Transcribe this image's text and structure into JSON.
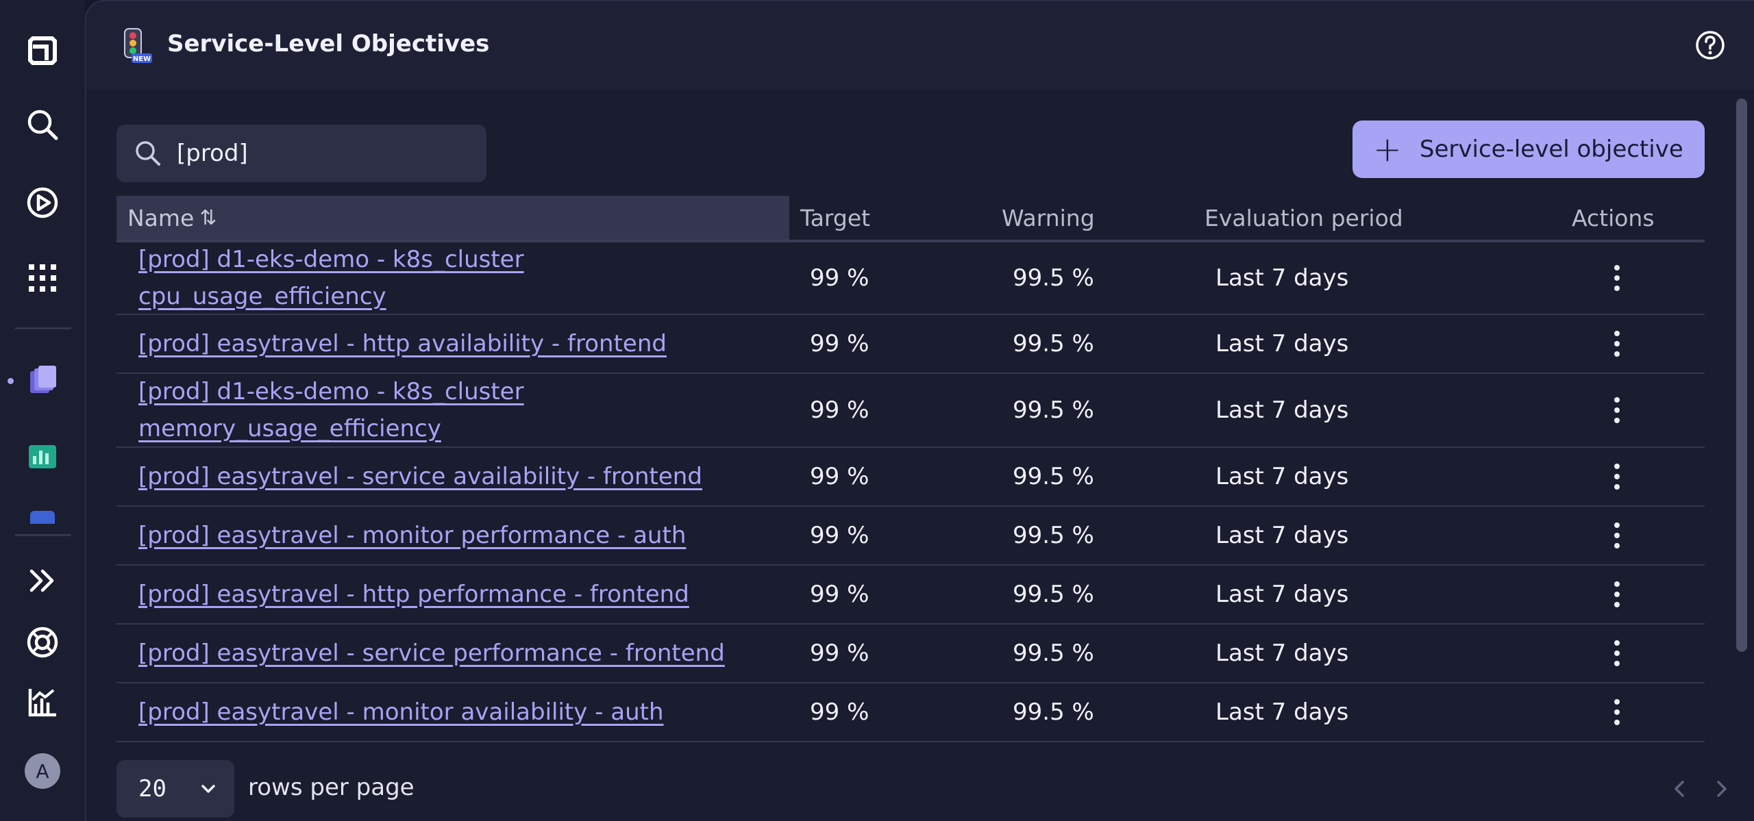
{
  "header": {
    "title": "Service-Level Objectives",
    "app_badge": "NEW"
  },
  "search": {
    "value": "[prod]",
    "placeholder": "Search"
  },
  "toolbar": {
    "add_button_label": "Service-level objective"
  },
  "table": {
    "columns": {
      "name": "Name",
      "target": "Target",
      "warning": "Warning",
      "evaluation_period": "Evaluation period",
      "actions": "Actions"
    },
    "rows": [
      {
        "name": "[prod] d1-eks-demo - k8s_cluster cpu_usage_efficiency",
        "target": "99 %",
        "warning": "99.5 %",
        "evaluation_period": "Last 7 days"
      },
      {
        "name": "[prod] easytravel - http availability - frontend",
        "target": "99 %",
        "warning": "99.5 %",
        "evaluation_period": "Last 7 days"
      },
      {
        "name": "[prod] d1-eks-demo - k8s_cluster memory_usage_efficiency",
        "target": "99 %",
        "warning": "99.5 %",
        "evaluation_period": "Last 7 days"
      },
      {
        "name": "[prod] easytravel - service availability - frontend",
        "target": "99 %",
        "warning": "99.5 %",
        "evaluation_period": "Last 7 days"
      },
      {
        "name": "[prod] easytravel - monitor performance - auth",
        "target": "99 %",
        "warning": "99.5 %",
        "evaluation_period": "Last 7 days"
      },
      {
        "name": "[prod] easytravel - http performance - frontend",
        "target": "99 %",
        "warning": "99.5 %",
        "evaluation_period": "Last 7 days"
      },
      {
        "name": "[prod] easytravel - service performance - frontend",
        "target": "99 %",
        "warning": "99.5 %",
        "evaluation_period": "Last 7 days"
      },
      {
        "name": "[prod] easytravel - monitor availability - auth",
        "target": "99 %",
        "warning": "99.5 %",
        "evaluation_period": "Last 7 days"
      }
    ]
  },
  "pagination": {
    "rows_per_page_value": "20",
    "rows_per_page_label": "rows per page"
  },
  "user": {
    "avatar_initial": "A"
  },
  "rail": {
    "icons": [
      "dynatrace-logo-icon",
      "search-icon",
      "play-circle-icon",
      "apps-grid-icon",
      "cube-stack-icon",
      "dashboard-chart-icon",
      "expand-chevrons-icon",
      "help-lifebuoy-icon",
      "bar-chart-icon"
    ]
  },
  "colors": {
    "accent": "#a7a4f5",
    "background": "#1a1c2f",
    "rail": "#1b1d30"
  }
}
